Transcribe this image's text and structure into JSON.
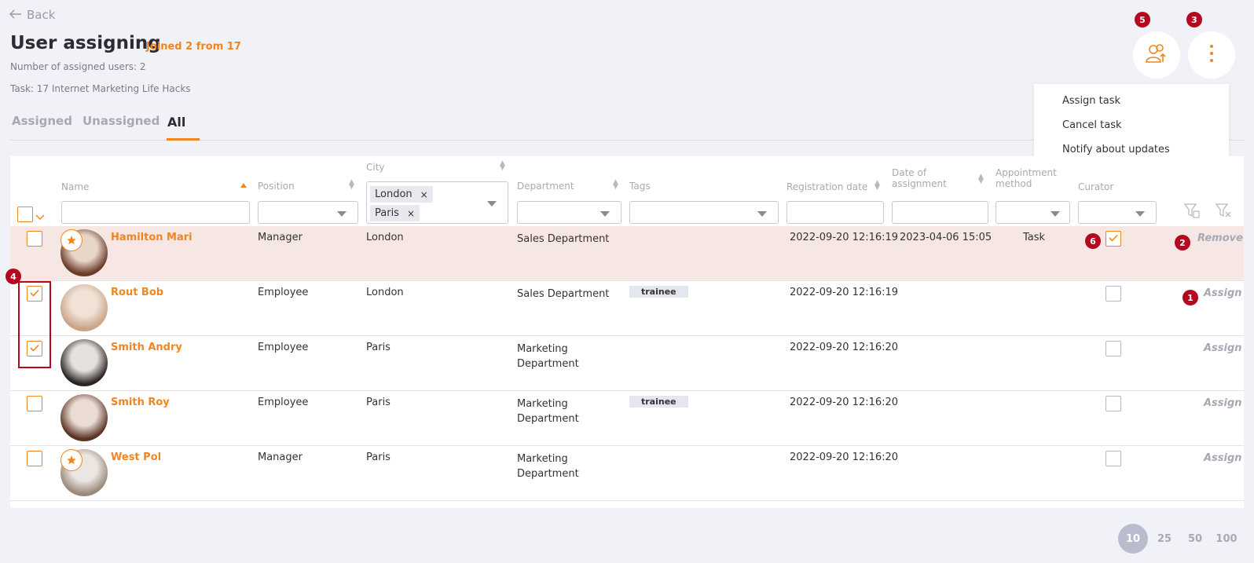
{
  "header": {
    "back_label": "Back",
    "title": "User assigning",
    "joined": "Joined 2 from 17",
    "assigned_count": "Number of assigned users: 2",
    "task": "Task: 17 Internet Marketing Life Hacks"
  },
  "tabs": [
    {
      "label": "Assigned"
    },
    {
      "label": "Unassigned"
    },
    {
      "label": "All",
      "active": true
    }
  ],
  "badges": {
    "b1": "1",
    "b2": "2",
    "b3": "3",
    "b4": "4",
    "b5": "5",
    "b6": "6"
  },
  "menu": {
    "items": [
      {
        "label": "Assign task"
      },
      {
        "label": "Cancel task"
      },
      {
        "label": "Notify about updates"
      }
    ]
  },
  "columns": {
    "name": "Name",
    "position": "Position",
    "city": "City",
    "department": "Department",
    "tags": "Tags",
    "registration": "Registration date",
    "date_assign_1": "Date of",
    "date_assign_2": "assignment",
    "appointment_1": "Appointment",
    "appointment_2": "method",
    "curator": "Curator"
  },
  "city_filter": {
    "chips": [
      "London",
      "Paris"
    ],
    "remove_glyph": "×"
  },
  "rows": [
    {
      "name": "Hamilton Mari",
      "position": "Manager",
      "city": "London",
      "dept1": "Sales Department",
      "dept2": "",
      "tag": "",
      "reg": "2022-09-20 12:16:19",
      "assigned": "2023-04-06 15:05",
      "method": "Task",
      "action": "Remove",
      "checked": false,
      "curator": true,
      "star": true,
      "highlight": true
    },
    {
      "name": "Rout Bob",
      "position": "Employee",
      "city": "London",
      "dept1": "Sales Department",
      "dept2": "",
      "tag": "trainee",
      "reg": "2022-09-20 12:16:19",
      "assigned": "",
      "method": "",
      "action": "Assign",
      "checked": true,
      "curator": false,
      "star": false,
      "highlight": false
    },
    {
      "name": "Smith Andry",
      "position": "Employee",
      "city": "Paris",
      "dept1": "Marketing",
      "dept2": "Department",
      "tag": "",
      "reg": "2022-09-20 12:16:20",
      "assigned": "",
      "method": "",
      "action": "Assign",
      "checked": true,
      "curator": false,
      "star": false,
      "highlight": false
    },
    {
      "name": "Smith Roy",
      "position": "Employee",
      "city": "Paris",
      "dept1": "Marketing",
      "dept2": "Department",
      "tag": "trainee",
      "reg": "2022-09-20 12:16:20",
      "assigned": "",
      "method": "",
      "action": "Assign",
      "checked": false,
      "curator": false,
      "star": false,
      "highlight": false
    },
    {
      "name": "West Pol",
      "position": "Manager",
      "city": "Paris",
      "dept1": "Marketing",
      "dept2": "Department",
      "tag": "",
      "reg": "2022-09-20 12:16:20",
      "assigned": "",
      "method": "",
      "action": "Assign",
      "checked": false,
      "curator": false,
      "star": true,
      "highlight": false
    }
  ],
  "pagination": {
    "sizes": [
      "10",
      "25",
      "50",
      "100"
    ],
    "active": "10"
  },
  "colors": {
    "accent": "#f0861f",
    "badge": "#b5081f",
    "highlight_row": "#f7e7e4"
  },
  "icons": {
    "assign_users": "users-arrow-icon",
    "more": "more-vertical-icon",
    "filter": "filter-icon",
    "clear_filter": "filter-clear-icon"
  }
}
